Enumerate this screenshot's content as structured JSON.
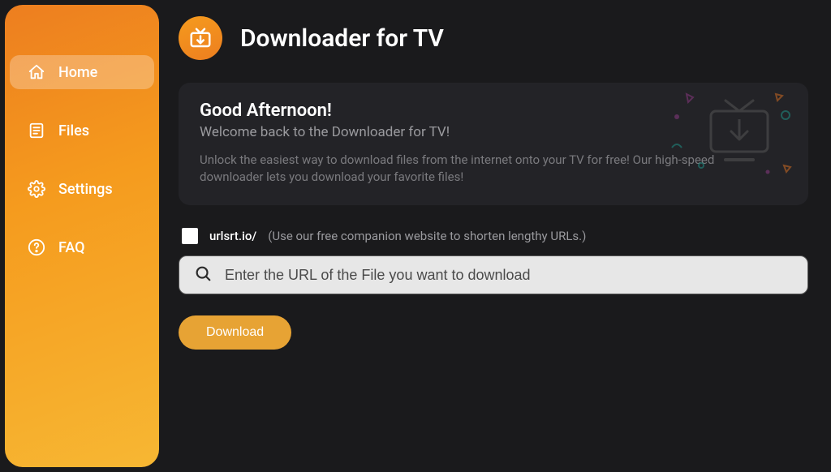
{
  "app": {
    "title": "Downloader for TV"
  },
  "sidebar": {
    "items": [
      {
        "label": "Home"
      },
      {
        "label": "Files"
      },
      {
        "label": "Settings"
      },
      {
        "label": "FAQ"
      }
    ]
  },
  "welcome": {
    "heading": "Good Afternoon!",
    "subheading": "Welcome back to the Downloader for TV!",
    "description": "Unlock the easiest way to download files from the internet onto your TV for free! Our high-speed downloader lets you download your favorite files!"
  },
  "shortener": {
    "label": "urlsrt.io/",
    "hint": "(Use our free companion website to shorten lengthy URLs.)"
  },
  "url_input": {
    "placeholder": "Enter the URL of the File you want to download"
  },
  "actions": {
    "download": "Download"
  }
}
